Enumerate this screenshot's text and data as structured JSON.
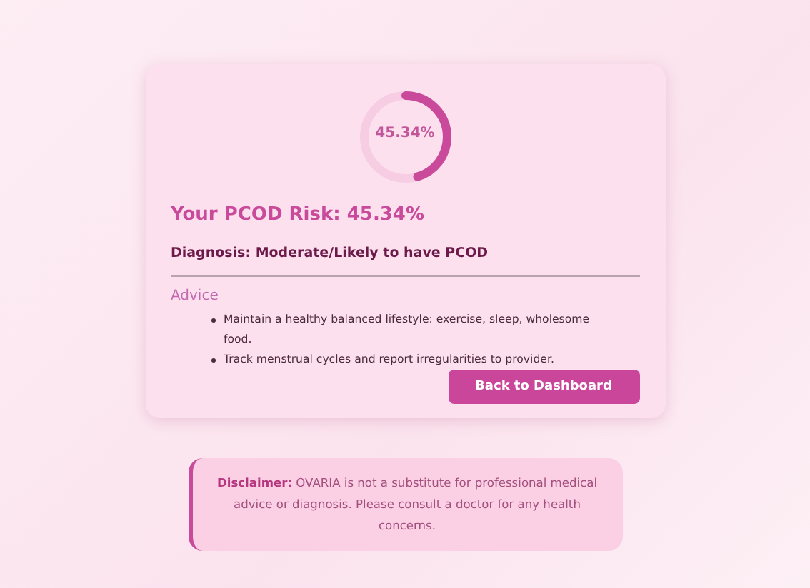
{
  "risk_ring": {
    "level": 0.4534,
    "label": "45.34%"
  },
  "title": "Your PCOD Risk: 45.34%",
  "diagnosis": "Diagnosis: Moderate/Likely to have PCOD",
  "advice": {
    "heading": "Advice",
    "items": [
      "Maintain a healthy balanced lifestyle: exercise, sleep, wholesome food.",
      "Track menstrual cycles and report irregularities to provider."
    ]
  },
  "button": "Back to Dashboard",
  "disclaimer": "**Disclaimer:** OVARIA is not a substitute for professional medical advice or diagnosis. Please consult a doctor for any health concerns."
}
